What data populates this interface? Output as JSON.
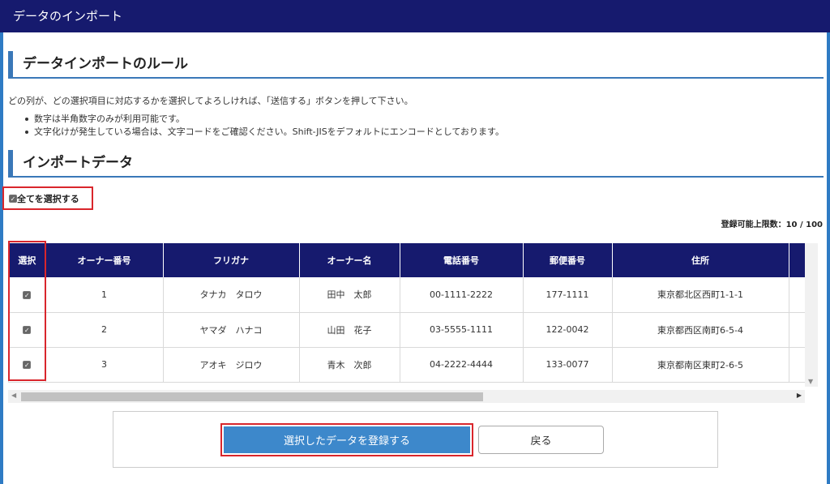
{
  "window_title": "データのインポート",
  "rules": {
    "heading": "データインポートのルール",
    "description": "どの列が、どの選択項目に対応するかを選択してよろしければ、「送信する」ボタンを押して下さい。",
    "bullets": [
      "数字は半角数字のみが利用可能です。",
      "文字化けが発生している場合は、文字コードをご確認ください。Shift-JISをデフォルトにエンコードとしております。"
    ]
  },
  "import": {
    "heading": "インポートデータ",
    "select_all_label": "全てを選択する",
    "select_all_checked": true,
    "limit_text": "登録可能上限数：10 / 100",
    "columns": [
      "選択",
      "オーナー番号",
      "フリガナ",
      "オーナー名",
      "電話番号",
      "郵便番号",
      "住所"
    ],
    "rows": [
      {
        "checked": true,
        "owner_no": "1",
        "kana": "タナカ　タロウ",
        "name": "田中　太郎",
        "phone": "00-1111-2222",
        "zip": "177-1111",
        "address": "東京都北区西町1-1-1"
      },
      {
        "checked": true,
        "owner_no": "2",
        "kana": "ヤマダ　ハナコ",
        "name": "山田　花子",
        "phone": "03-5555-1111",
        "zip": "122-0042",
        "address": "東京都西区南町6-5-4"
      },
      {
        "checked": true,
        "owner_no": "3",
        "kana": "アオキ　ジロウ",
        "name": "青木　次郎",
        "phone": "04-2222-4444",
        "zip": "133-0077",
        "address": "東京都南区東町2-6-5"
      }
    ]
  },
  "buttons": {
    "submit_label": "選択したデータを登録する",
    "back_label": "戻る"
  },
  "colors": {
    "header_bg": "#161a6e",
    "accent": "#3a78b8",
    "highlight": "#d9262c",
    "submit_bg": "#3d88cb"
  }
}
